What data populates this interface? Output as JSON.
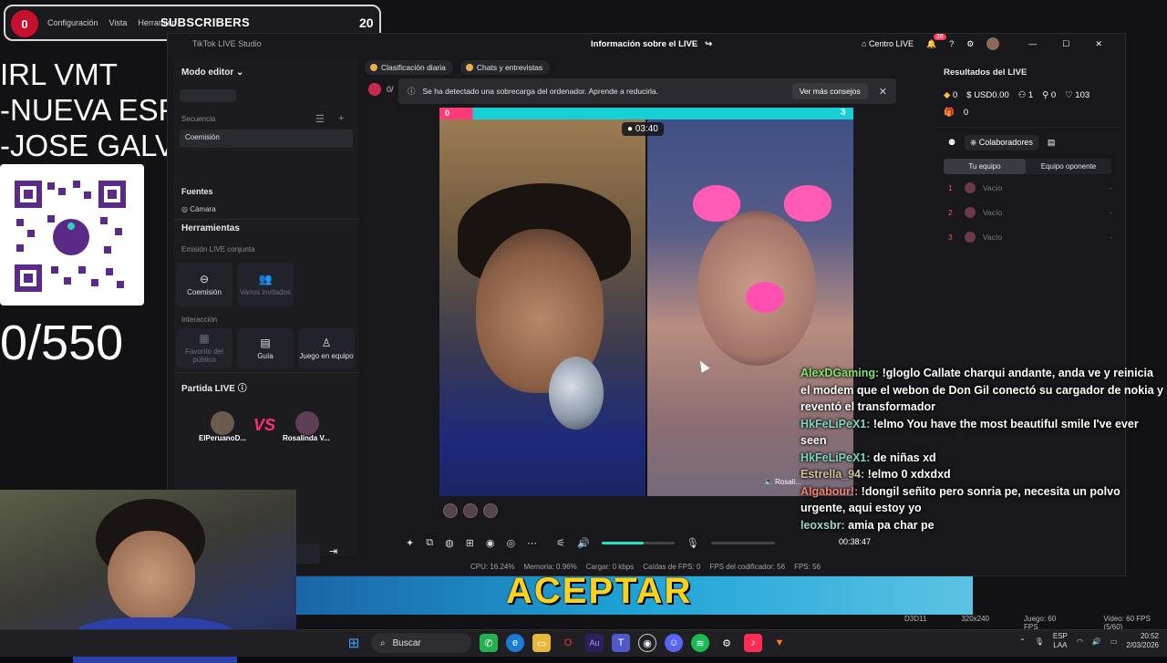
{
  "subscriber_bar": {
    "left_count": "0",
    "label": "SUBSCRIBERS",
    "right_count": "20",
    "menu": [
      "Configuración",
      "Vista",
      "Herramien"
    ]
  },
  "overlay": {
    "lines": [
      "IRL VMT",
      "-NUEVA ESPERANZA",
      "-JOSE GALVEZ"
    ],
    "goal": "0/550",
    "qr_label": "yape"
  },
  "studio": {
    "app_title": "TikTok LIVE Studio",
    "center_title": "Información sobre el LIVE",
    "top_right": {
      "home_label": "Centro LIVE",
      "notif_count": "26"
    },
    "mode_label": "Modo editor",
    "scene_labels": [
      "Secuencia",
      "Coemisión"
    ],
    "sources_title": "Fuentes",
    "sources_item": "Cámara",
    "tools_title": "Herramientas",
    "joint_live_label": "Emisión LIVE conjunta",
    "tool_coemision": "Coemisión",
    "tool_invitados": "Varios invitados",
    "interaction_label": "Interacción",
    "tool_favorito": "Favorito del público",
    "tool_guia": "Guía",
    "tool_juego": "Juego en equipo",
    "match_title": "Partida LIVE",
    "player_left": "ElPeruanoD...",
    "vs_label": "VS",
    "player_right": "Rosalinda V...",
    "chips": [
      "Clasificación diaria",
      "Chats y entrevistas"
    ],
    "alert_text": "Se ha detectado una sobrecarga del ordenador. Aprende a reducirla.",
    "alert_button": "Ver más consejos",
    "counter_partial": "0/",
    "video": {
      "score_left": "0",
      "score_right": "3",
      "timer": "03:40",
      "guest_name": "Rosali..."
    },
    "elapsed": "00:38:47",
    "stats": [
      "CPU: 16.24%",
      "Memoria: 0.96%",
      "Cargar: 0 kbps",
      "Caídas de FPS: 0",
      "FPS del codificador: 56",
      "FPS: 56"
    ],
    "volume_level": 0.58,
    "results": {
      "title": "Resultados del LIVE",
      "diamonds": "0",
      "usd": "USD0.00",
      "viewers": "1",
      "follows": "0",
      "likes": "103",
      "gifts": "0"
    },
    "collab_tab": "Colaboradores",
    "team_tabs": [
      "Tu equipo",
      "Equipo oponente"
    ],
    "slots": [
      {
        "n": "1",
        "label": "Vacío",
        "value": "-"
      },
      {
        "n": "2",
        "label": "Vacío",
        "value": "-"
      },
      {
        "n": "3",
        "label": "Vacío",
        "value": "-"
      }
    ]
  },
  "chat": [
    {
      "user": "AlexDGaming:",
      "text": " !gloglo Callate charqui andante, anda ve y reinicia el modem que el webon de Don Gil conectó su cargador de nokia y reventó el transformador",
      "cls": "u"
    },
    {
      "user": "HkFeLiPeX1:",
      "text": " !elmo You have the most beautiful smile I've ever seen",
      "cls": "u3"
    },
    {
      "user": "HkFeLiPeX1:",
      "text": " de niñas xd",
      "cls": "u3"
    },
    {
      "user": "Estrella_94:",
      "text": " !elmo 0 xdxdxd",
      "cls": "u4"
    },
    {
      "user": "Algabour!:",
      "text": " !dongil señito pero sonria pe, necesita un polvo urgente, aqui estoy yo",
      "cls": "u5"
    },
    {
      "user": "leoxsbr:",
      "text": " amia pa char pe",
      "cls": "u6"
    }
  ],
  "banner": {
    "text": "ACEPTAR"
  },
  "obs_status": [
    "D3D11",
    "320x240",
    "Juego: 60 FPS",
    "Video: 60 FPS (5/60)"
  ],
  "taskbar": {
    "search_placeholder": "Buscar",
    "lang": "ESP",
    "lang2": "LAA",
    "time": "20:52",
    "date": "2/03/2026"
  },
  "colors": {
    "accent": "#1ee3c5",
    "tiktok_red": "#ff3b77",
    "alert_bg": "#2a2a30"
  }
}
